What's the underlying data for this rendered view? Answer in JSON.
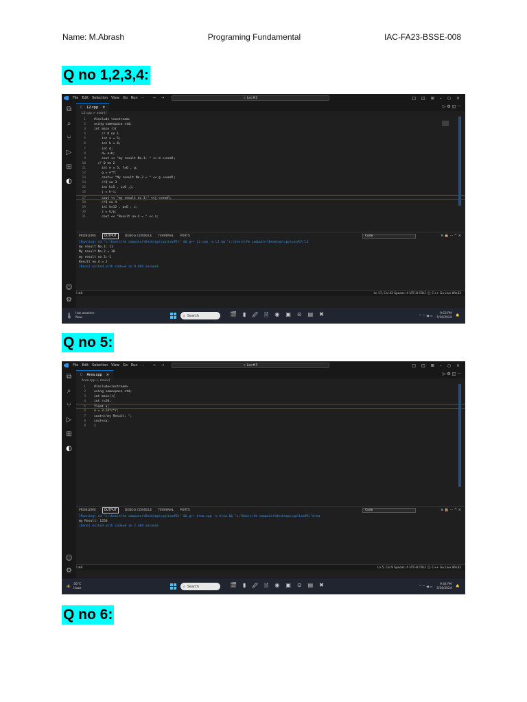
{
  "header": {
    "name": "Name: M.Abrash",
    "course": "Programing Fundamental",
    "reg_id": "IAC-FA23-BSSE-008"
  },
  "sections": [
    {
      "heading": "Q no 1,2,3,4:"
    },
    {
      "heading": "Q no 5:"
    },
    {
      "heading": "Q no 6:"
    }
  ],
  "vscode_common": {
    "menu": [
      "File",
      "Edit",
      "Selection",
      "View",
      "Go",
      "Run",
      "···"
    ],
    "nav_arrows": "← →",
    "window_controls": [
      "□",
      "◫",
      "⊞",
      "–",
      "○",
      "×"
    ],
    "tab_actions": "▷ ⚙ ◫ ···",
    "panel_tabs": [
      "PROBLEMS",
      "OUTPUT",
      "DEBUG CONSOLE",
      "TERMINAL",
      "PORTS"
    ],
    "panel_select": "Code",
    "panel_icons": "≡ 🔒 ··· ^ ×",
    "status_left": "⚡ ⊗0 ⚠0  ⊛0",
    "status_right_tail": "Spaces: 4   UTF-8   CRLF   {} C++   Go Live   Win32",
    "taskbar_search": "Search",
    "taskbar_apps": [
      "🎬",
      "▮",
      "🖉",
      "🗎",
      "◉",
      "▣",
      "⊙",
      "▤",
      "✖"
    ]
  },
  "screenshot1": {
    "command_center": "Lec#2",
    "tab": "L2.cpp",
    "breadcrumb": "L2.cpp > main()",
    "code": [
      {
        "n": "1",
        "t": "#include <iostream>"
      },
      {
        "n": "2",
        "t": "using namespace std;"
      },
      {
        "n": "3",
        "t": "int main (){"
      },
      {
        "n": "4",
        "t": "    // Q no 1"
      },
      {
        "n": "5",
        "t": "    int a = 5;"
      },
      {
        "n": "6",
        "t": "    int b = 6;"
      },
      {
        "n": "7",
        "t": "    int d;"
      },
      {
        "n": "8",
        "t": "    d= a+b;"
      },
      {
        "n": "9",
        "t": "    cout << \"my result No.1: \" << d <<endl;"
      },
      {
        "n": "10",
        "t": "  // Q no 2"
      },
      {
        "n": "11",
        "t": "    int e = 5, f=6 , g;"
      },
      {
        "n": "12",
        "t": "    g = e*f;"
      },
      {
        "n": "13",
        "t": "    cout<< \"My result No.2 = \" << g <<endl;"
      },
      {
        "n": "14",
        "t": "    //Q no 3"
      },
      {
        "n": "15",
        "t": "    int h=5 , i=6 ,j;"
      },
      {
        "n": "16",
        "t": "    j = h-i;"
      },
      {
        "n": "17",
        "t": "    cout << \"my result no 3:\" <<j <<endl;"
      },
      {
        "n": "18",
        "t": "    //Q no 4"
      },
      {
        "n": "19",
        "t": "    int k=12 , p=6 , z;"
      },
      {
        "n": "20",
        "t": "    z = k/p;"
      },
      {
        "n": "21",
        "t": "    cout << \"Result no.4 = \" << z;"
      }
    ],
    "highlight_line": "17",
    "output": [
      {
        "cls": "out-cmd",
        "t": "[Running] cd \"c:\\Users\\fm computer\\Desktop\\cpp\\Lec#2\\\" && g++ L2.cpp -o L2 && \"c:\\Users\\fm computer\\Desktop\\cpp\\Lec#2\\\"L2"
      },
      {
        "cls": "out-res",
        "t": "my result No.1: 11"
      },
      {
        "cls": "out-res",
        "t": "My result No.2 = 30"
      },
      {
        "cls": "out-res",
        "t": "my result no 3:-1"
      },
      {
        "cls": "out-res",
        "t": "Result no.4 = 2"
      },
      {
        "cls": "out-cmd",
        "t": "[Done] exited with code=0 in 0.694 seconds"
      }
    ],
    "status_pos": "Ln 17, Col 42",
    "weather_line1": "Hot weather",
    "weather_line2": "Now",
    "weather_icon": "🌡",
    "clock_time": "9:53 PM",
    "clock_date": "5/16/2024"
  },
  "screenshot2": {
    "command_center": "Lec#3",
    "tab": "Area.cpp",
    "breadcrumb": "Area.cpp > main()",
    "code": [
      {
        "n": "1",
        "t": "#include<iostream>"
      },
      {
        "n": "2",
        "t": "using namespace std;"
      },
      {
        "n": "3",
        "t": "int main(){"
      },
      {
        "n": "4",
        "t": "int r=20;"
      },
      {
        "n": "5",
        "t": "float a;"
      },
      {
        "n": "6",
        "t": "a = 3.14*r*r;"
      },
      {
        "n": "7",
        "t": "cout<<\"my Result: \";"
      },
      {
        "n": "8",
        "t": "cout<<a;"
      },
      {
        "n": "9",
        "t": "}"
      }
    ],
    "highlight_line": "5",
    "output": [
      {
        "cls": "out-cmd",
        "t": "[Running] cd \"c:\\Users\\fm computer\\Desktop\\cpp\\Lec#3\\\" && g++ Area.cpp -o Area && \"c:\\Users\\fm computer\\Desktop\\cpp\\Lec#3\\\"Area"
      },
      {
        "cls": "out-res",
        "t": "my Result: 1256"
      },
      {
        "cls": "out-cmd",
        "t": "[Done] exited with code=0 in 2.369 seconds"
      }
    ],
    "status_pos": "Ln 5, Col 9",
    "weather_line1": "36°C",
    "weather_line2": "Haze",
    "weather_icon": "☀",
    "clock_time": "9:44 PM",
    "clock_date": "5/16/2024"
  }
}
